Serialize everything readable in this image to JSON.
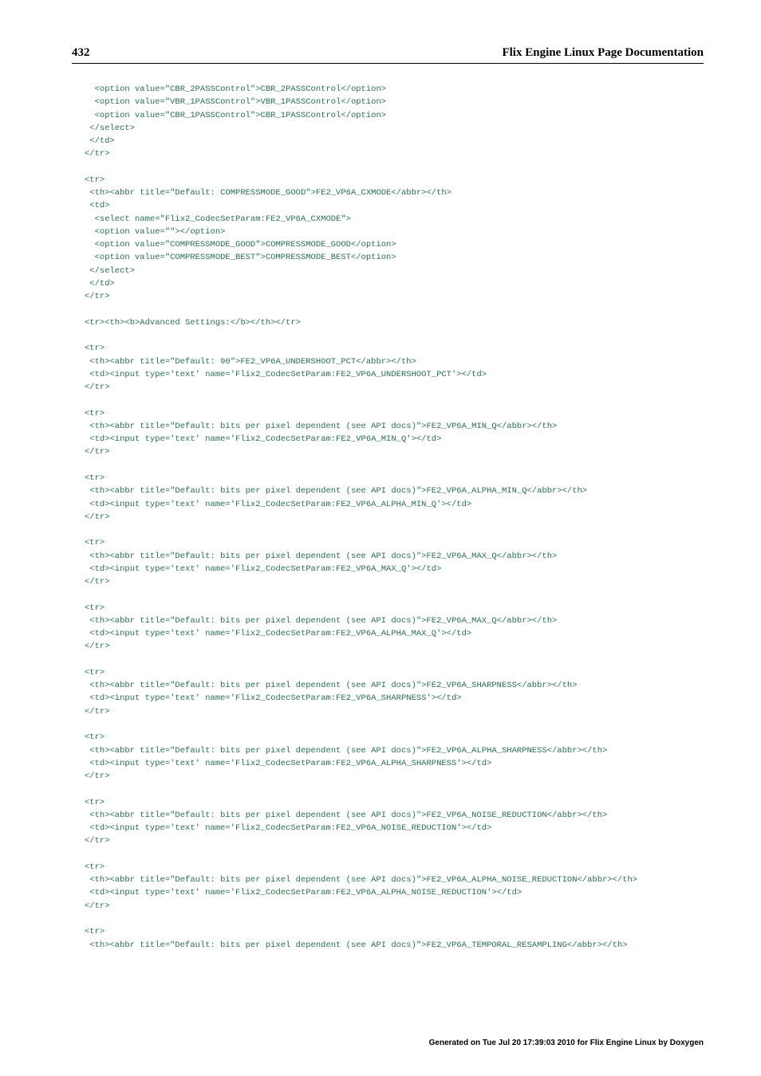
{
  "header": {
    "page_number": "432",
    "doc_title": "Flix Engine Linux Page Documentation"
  },
  "code": "  <option value=\"CBR_2PASSControl\">CBR_2PASSControl</option>\n  <option value=\"VBR_1PASSControl\">VBR_1PASSControl</option>\n  <option value=\"CBR_1PASSControl\">CBR_1PASSControl</option>\n </select>\n </td>\n</tr>\n\n<tr>\n <th><abbr title=\"Default: COMPRESSMODE_GOOD\">FE2_VP6A_CXMODE</abbr></th>\n <td>\n  <select name=\"Flix2_CodecSetParam:FE2_VP6A_CXMODE\">\n  <option value=\"\"></option>\n  <option value=\"COMPRESSMODE_GOOD\">COMPRESSMODE_GOOD</option>\n  <option value=\"COMPRESSMODE_BEST\">COMPRESSMODE_BEST</option>\n </select>\n </td>\n</tr>\n\n<tr><th><b>Advanced Settings:</b></th></tr>\n\n<tr>\n <th><abbr title=\"Default: 90\">FE2_VP6A_UNDERSHOOT_PCT</abbr></th>\n <td><input type='text' name='Flix2_CodecSetParam:FE2_VP6A_UNDERSHOOT_PCT'></td>\n</tr>\n\n<tr>\n <th><abbr title=\"Default: bits per pixel dependent (see API docs)\">FE2_VP6A_MIN_Q</abbr></th>\n <td><input type='text' name='Flix2_CodecSetParam:FE2_VP6A_MIN_Q'></td>\n</tr>\n\n<tr>\n <th><abbr title=\"Default: bits per pixel dependent (see API docs)\">FE2_VP6A_ALPHA_MIN_Q</abbr></th>\n <td><input type='text' name='Flix2_CodecSetParam:FE2_VP6A_ALPHA_MIN_Q'></td>\n</tr>\n\n<tr>\n <th><abbr title=\"Default: bits per pixel dependent (see API docs)\">FE2_VP6A_MAX_Q</abbr></th>\n <td><input type='text' name='Flix2_CodecSetParam:FE2_VP6A_MAX_Q'></td>\n</tr>\n\n<tr>\n <th><abbr title=\"Default: bits per pixel dependent (see API docs)\">FE2_VP6A_MAX_Q</abbr></th>\n <td><input type='text' name='Flix2_CodecSetParam:FE2_VP6A_ALPHA_MAX_Q'></td>\n</tr>\n\n<tr>\n <th><abbr title=\"Default: bits per pixel dependent (see API docs)\">FE2_VP6A_SHARPNESS</abbr></th>\n <td><input type='text' name='Flix2_CodecSetParam:FE2_VP6A_SHARPNESS'></td>\n</tr>\n\n<tr>\n <th><abbr title=\"Default: bits per pixel dependent (see API docs)\">FE2_VP6A_ALPHA_SHARPNESS</abbr></th>\n <td><input type='text' name='Flix2_CodecSetParam:FE2_VP6A_ALPHA_SHARPNESS'></td>\n</tr>\n\n<tr>\n <th><abbr title=\"Default: bits per pixel dependent (see API docs)\">FE2_VP6A_NOISE_REDUCTION</abbr></th>\n <td><input type='text' name='Flix2_CodecSetParam:FE2_VP6A_NOISE_REDUCTION'></td>\n</tr>\n\n<tr>\n <th><abbr title=\"Default: bits per pixel dependent (see API docs)\">FE2_VP6A_ALPHA_NOISE_REDUCTION</abbr></th>\n <td><input type='text' name='Flix2_CodecSetParam:FE2_VP6A_ALPHA_NOISE_REDUCTION'></td>\n</tr>\n\n<tr>\n <th><abbr title=\"Default: bits per pixel dependent (see API docs)\">FE2_VP6A_TEMPORAL_RESAMPLING</abbr></th>",
  "footer": "Generated on Tue Jul 20 17:39:03 2010 for Flix Engine Linux by Doxygen"
}
